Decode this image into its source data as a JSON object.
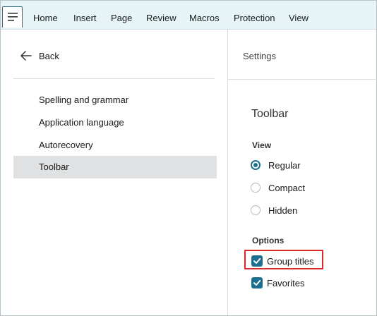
{
  "menubar": {
    "items": [
      {
        "label": "Home"
      },
      {
        "label": "Insert"
      },
      {
        "label": "Page"
      },
      {
        "label": "Review"
      },
      {
        "label": "Macros"
      },
      {
        "label": "Protection"
      },
      {
        "label": "View"
      }
    ]
  },
  "left": {
    "back_label": "Back",
    "nav": [
      {
        "label": "Spelling and grammar"
      },
      {
        "label": "Application language"
      },
      {
        "label": "Autorecovery"
      },
      {
        "label": "Toolbar"
      }
    ]
  },
  "right": {
    "header": "Settings",
    "section_title": "Toolbar",
    "view_group": {
      "label": "View",
      "options": [
        {
          "label": "Regular",
          "checked": true
        },
        {
          "label": "Compact",
          "checked": false
        },
        {
          "label": "Hidden",
          "checked": false
        }
      ]
    },
    "options_group": {
      "label": "Options",
      "checkboxes": [
        {
          "label": "Group titles",
          "checked": true
        },
        {
          "label": "Favorites",
          "checked": true
        }
      ]
    }
  },
  "colors": {
    "accent": "#1d6f8f",
    "menubar_bg": "#e6f4f7",
    "active_nav_bg": "#dfe1e3",
    "highlight": "#d92b2b"
  }
}
